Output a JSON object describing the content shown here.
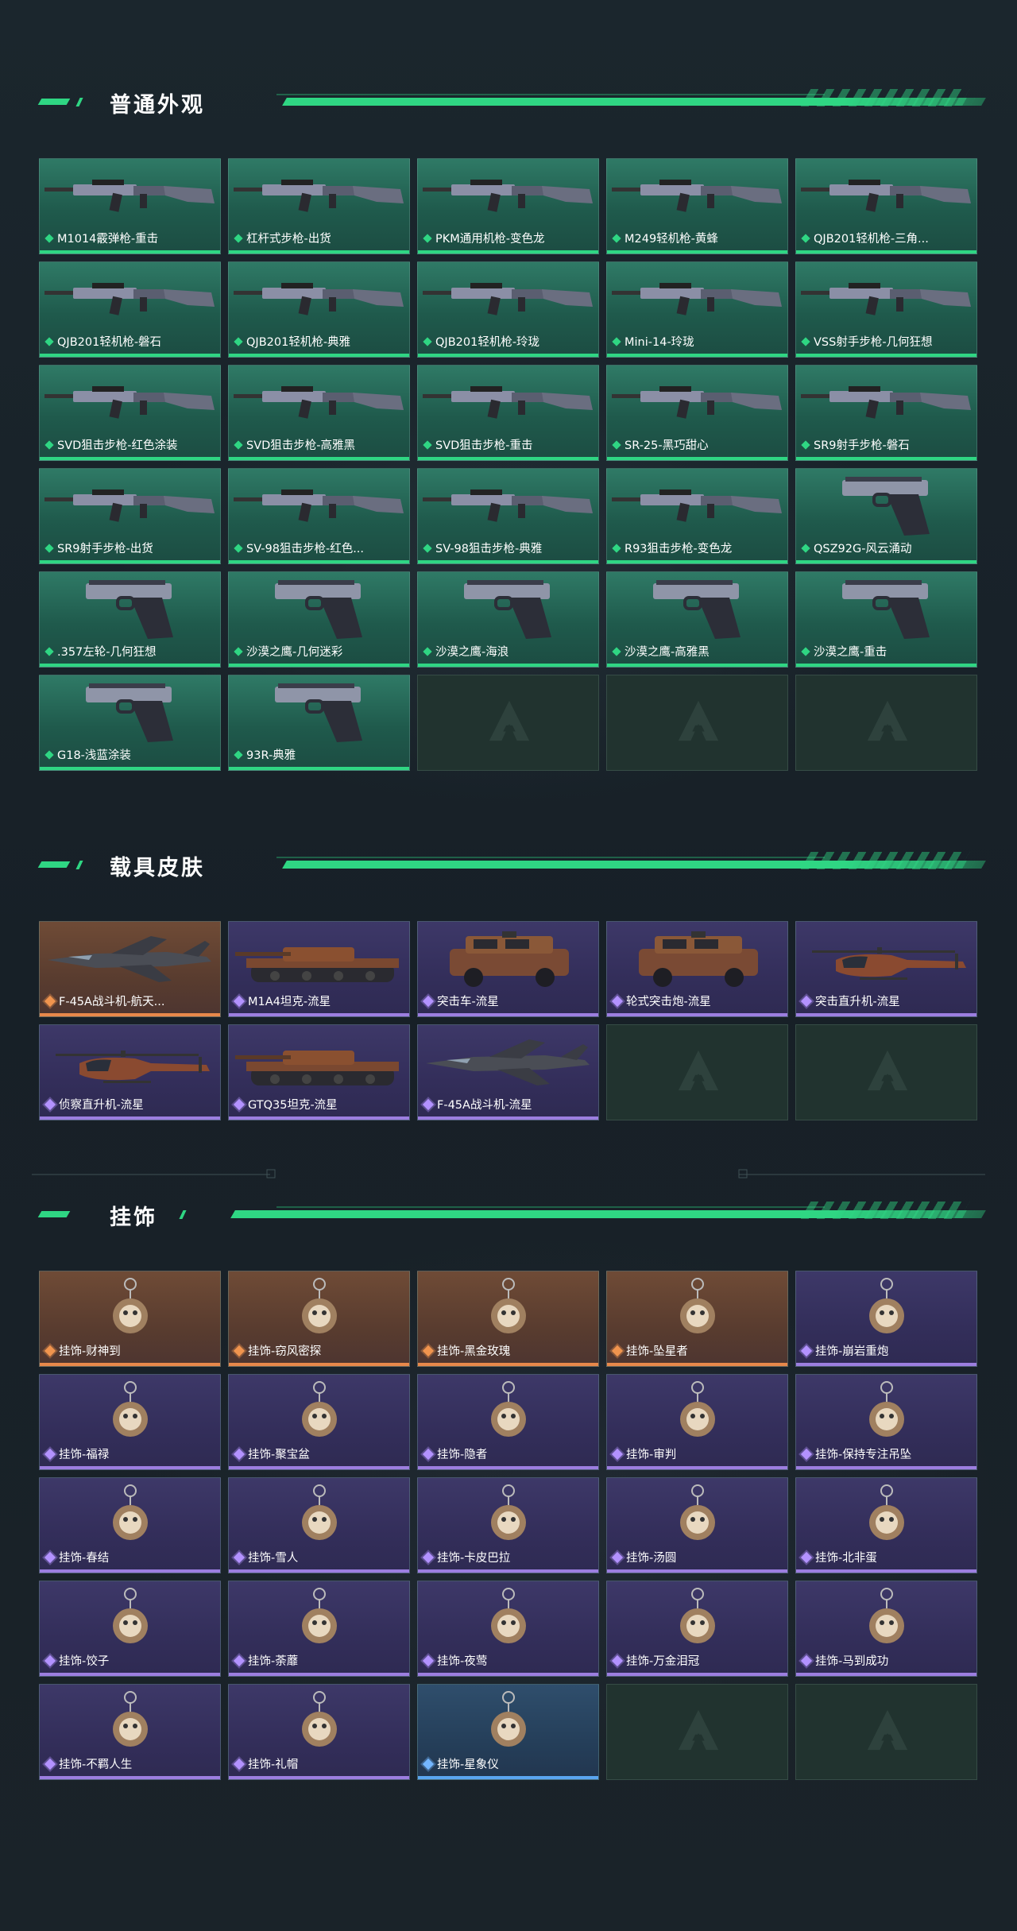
{
  "sections": [
    {
      "title": "普通外观",
      "items": [
        {
          "label": "M1014霰弹枪-重击",
          "rarity": "green",
          "kind": "gun"
        },
        {
          "label": "杠杆式步枪-出货",
          "rarity": "green",
          "kind": "gun"
        },
        {
          "label": "PKM通用机枪-变色龙",
          "rarity": "green",
          "kind": "gun"
        },
        {
          "label": "M249轻机枪-黄蜂",
          "rarity": "green",
          "kind": "gun"
        },
        {
          "label": "QJB201轻机枪-三角...",
          "rarity": "green",
          "kind": "gun"
        },
        {
          "label": "QJB201轻机枪-磐石",
          "rarity": "green",
          "kind": "gun"
        },
        {
          "label": "QJB201轻机枪-典雅",
          "rarity": "green",
          "kind": "gun"
        },
        {
          "label": "QJB201轻机枪-玲珑",
          "rarity": "green",
          "kind": "gun"
        },
        {
          "label": "Mini-14-玲珑",
          "rarity": "green",
          "kind": "gun"
        },
        {
          "label": "VSS射手步枪-几何狂想",
          "rarity": "green",
          "kind": "gun"
        },
        {
          "label": "SVD狙击步枪-红色涂装",
          "rarity": "green",
          "kind": "gun"
        },
        {
          "label": "SVD狙击步枪-高雅黑",
          "rarity": "green",
          "kind": "gun"
        },
        {
          "label": "SVD狙击步枪-重击",
          "rarity": "green",
          "kind": "gun"
        },
        {
          "label": "SR-25-黑巧甜心",
          "rarity": "green",
          "kind": "gun"
        },
        {
          "label": "SR9射手步枪-磐石",
          "rarity": "green",
          "kind": "gun"
        },
        {
          "label": "SR9射手步枪-出货",
          "rarity": "green",
          "kind": "gun"
        },
        {
          "label": "SV-98狙击步枪-红色...",
          "rarity": "green",
          "kind": "gun"
        },
        {
          "label": "SV-98狙击步枪-典雅",
          "rarity": "green",
          "kind": "gun"
        },
        {
          "label": "R93狙击步枪-变色龙",
          "rarity": "green",
          "kind": "gun"
        },
        {
          "label": "QSZ92G-风云涌动",
          "rarity": "green",
          "kind": "pistol"
        },
        {
          "label": ".357左轮-几何狂想",
          "rarity": "green",
          "kind": "pistol"
        },
        {
          "label": "沙漠之鹰-几何迷彩",
          "rarity": "green",
          "kind": "pistol"
        },
        {
          "label": "沙漠之鹰-海浪",
          "rarity": "green",
          "kind": "pistol"
        },
        {
          "label": "沙漠之鹰-高雅黑",
          "rarity": "green",
          "kind": "pistol"
        },
        {
          "label": "沙漠之鹰-重击",
          "rarity": "green",
          "kind": "pistol"
        },
        {
          "label": "G18-浅蓝涂装",
          "rarity": "green",
          "kind": "pistol"
        },
        {
          "label": "93R-典雅",
          "rarity": "green",
          "kind": "pistol"
        }
      ],
      "empty": 3
    },
    {
      "title": "载具皮肤",
      "items": [
        {
          "label": "F-45A战斗机-航天...",
          "rarity": "orange",
          "kind": "jet"
        },
        {
          "label": "M1A4坦克-流星",
          "rarity": "purple",
          "kind": "tank"
        },
        {
          "label": "突击车-流星",
          "rarity": "purple",
          "kind": "car"
        },
        {
          "label": "轮式突击炮-流星",
          "rarity": "purple",
          "kind": "car"
        },
        {
          "label": "突击直升机-流星",
          "rarity": "purple",
          "kind": "heli"
        },
        {
          "label": "侦察直升机-流星",
          "rarity": "purple",
          "kind": "heli"
        },
        {
          "label": "GTQ35坦克-流星",
          "rarity": "purple",
          "kind": "tank"
        },
        {
          "label": "F-45A战斗机-流星",
          "rarity": "purple",
          "kind": "jet"
        }
      ],
      "empty": 2
    },
    {
      "title": "挂饰",
      "items": [
        {
          "label": "挂饰-财神到",
          "rarity": "orange",
          "kind": "charm"
        },
        {
          "label": "挂饰-窃风密探",
          "rarity": "orange",
          "kind": "charm"
        },
        {
          "label": "挂饰-黑金玫瑰",
          "rarity": "orange",
          "kind": "charm"
        },
        {
          "label": "挂饰-坠星者",
          "rarity": "orange",
          "kind": "charm"
        },
        {
          "label": "挂饰-崩岩重炮",
          "rarity": "purple",
          "kind": "charm"
        },
        {
          "label": "挂饰-福禄",
          "rarity": "purple",
          "kind": "charm"
        },
        {
          "label": "挂饰-聚宝盆",
          "rarity": "purple",
          "kind": "charm"
        },
        {
          "label": "挂饰-隐者",
          "rarity": "purple",
          "kind": "charm"
        },
        {
          "label": "挂饰-审判",
          "rarity": "purple",
          "kind": "charm"
        },
        {
          "label": "挂饰-保持专注吊坠",
          "rarity": "purple",
          "kind": "charm"
        },
        {
          "label": "挂饰-春结",
          "rarity": "purple",
          "kind": "charm"
        },
        {
          "label": "挂饰-雪人",
          "rarity": "purple",
          "kind": "charm"
        },
        {
          "label": "挂饰-卡皮巴拉",
          "rarity": "purple",
          "kind": "charm"
        },
        {
          "label": "挂饰-汤圆",
          "rarity": "purple",
          "kind": "charm"
        },
        {
          "label": "挂饰-北非蛋",
          "rarity": "purple",
          "kind": "charm"
        },
        {
          "label": "挂饰-饺子",
          "rarity": "purple",
          "kind": "charm"
        },
        {
          "label": "挂饰-荼蘼",
          "rarity": "purple",
          "kind": "charm"
        },
        {
          "label": "挂饰-夜莺",
          "rarity": "purple",
          "kind": "charm"
        },
        {
          "label": "挂饰-万金泪冠",
          "rarity": "purple",
          "kind": "charm"
        },
        {
          "label": "挂饰-马到成功",
          "rarity": "purple",
          "kind": "charm"
        },
        {
          "label": "挂饰-不羁人生",
          "rarity": "purple",
          "kind": "charm"
        },
        {
          "label": "挂饰-礼帽",
          "rarity": "purple",
          "kind": "charm"
        },
        {
          "label": "挂饰-星象仪",
          "rarity": "blue",
          "kind": "charm"
        }
      ],
      "empty": 2
    }
  ],
  "colors": {
    "green": "#2fd683",
    "purple": "#9c7ee0",
    "orange": "#e8884a",
    "blue": "#5aa6f0",
    "background": "#19232a"
  }
}
